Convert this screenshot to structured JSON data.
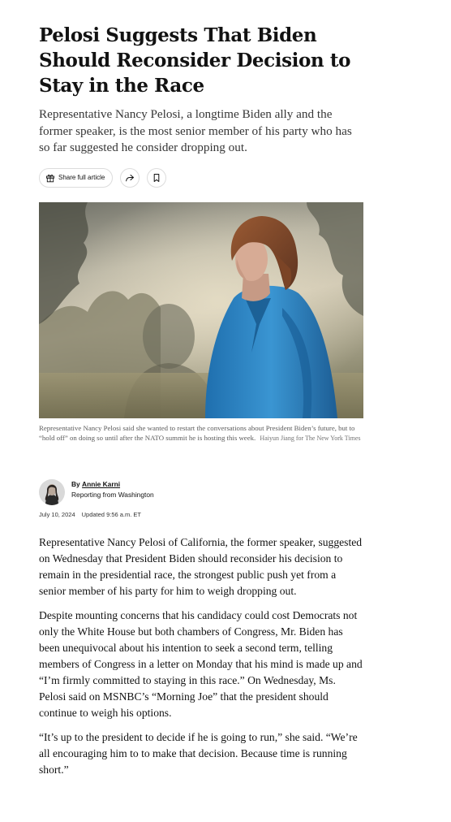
{
  "article": {
    "headline": "Pelosi Suggests That Biden Should Reconsider Decision to Stay in the Race",
    "summary": "Representative Nancy Pelosi, a longtime Biden ally and the former speaker, is the most senior member of his party who has so far suggested he consider dropping out.",
    "share_label": "Share full article",
    "share_icon": "gift-icon",
    "forward_icon": "share-arrow-icon",
    "bookmark_icon": "bookmark-icon"
  },
  "photo": {
    "caption": "Representative Nancy Pelosi said she wanted to restart the conversations about President Biden’s future, but to “hold off” on doing so until after the NATO summit he is hosting this week.",
    "credit": "Haiyun Jiang for The New York Times"
  },
  "byline": {
    "by": "By",
    "author": "Annie Karni",
    "reporting": "Reporting from Washington",
    "date": "July 10, 2024",
    "updated": "Updated 9:56 a.m. ET"
  },
  "body": {
    "paragraphs": [
      "Representative Nancy Pelosi of California, the former speaker, suggested on Wednesday that President Biden should reconsider his decision to remain in the presidential race, the strongest public push yet from a senior member of his party for him to weigh dropping out.",
      "Despite mounting concerns that his candidacy could cost Democrats not only the White House but both chambers of Congress, Mr. Biden has been unequivocal about his intention to seek a second term, telling members of Congress in a letter on Monday that his mind is made up and “I’m firmly committed to staying in this race.” On Wednesday, Ms. Pelosi said on MSNBC’s “Morning Joe” that the president should continue to weigh his options.",
      "“It’s up to the president to decide if he is going to run,” she said. “We’re all encouraging him to to make that decision. Because time is running short.”"
    ]
  },
  "colors": {
    "text": "#121212",
    "blouse": "#2f86c4",
    "sky": "#c9c3b3"
  }
}
